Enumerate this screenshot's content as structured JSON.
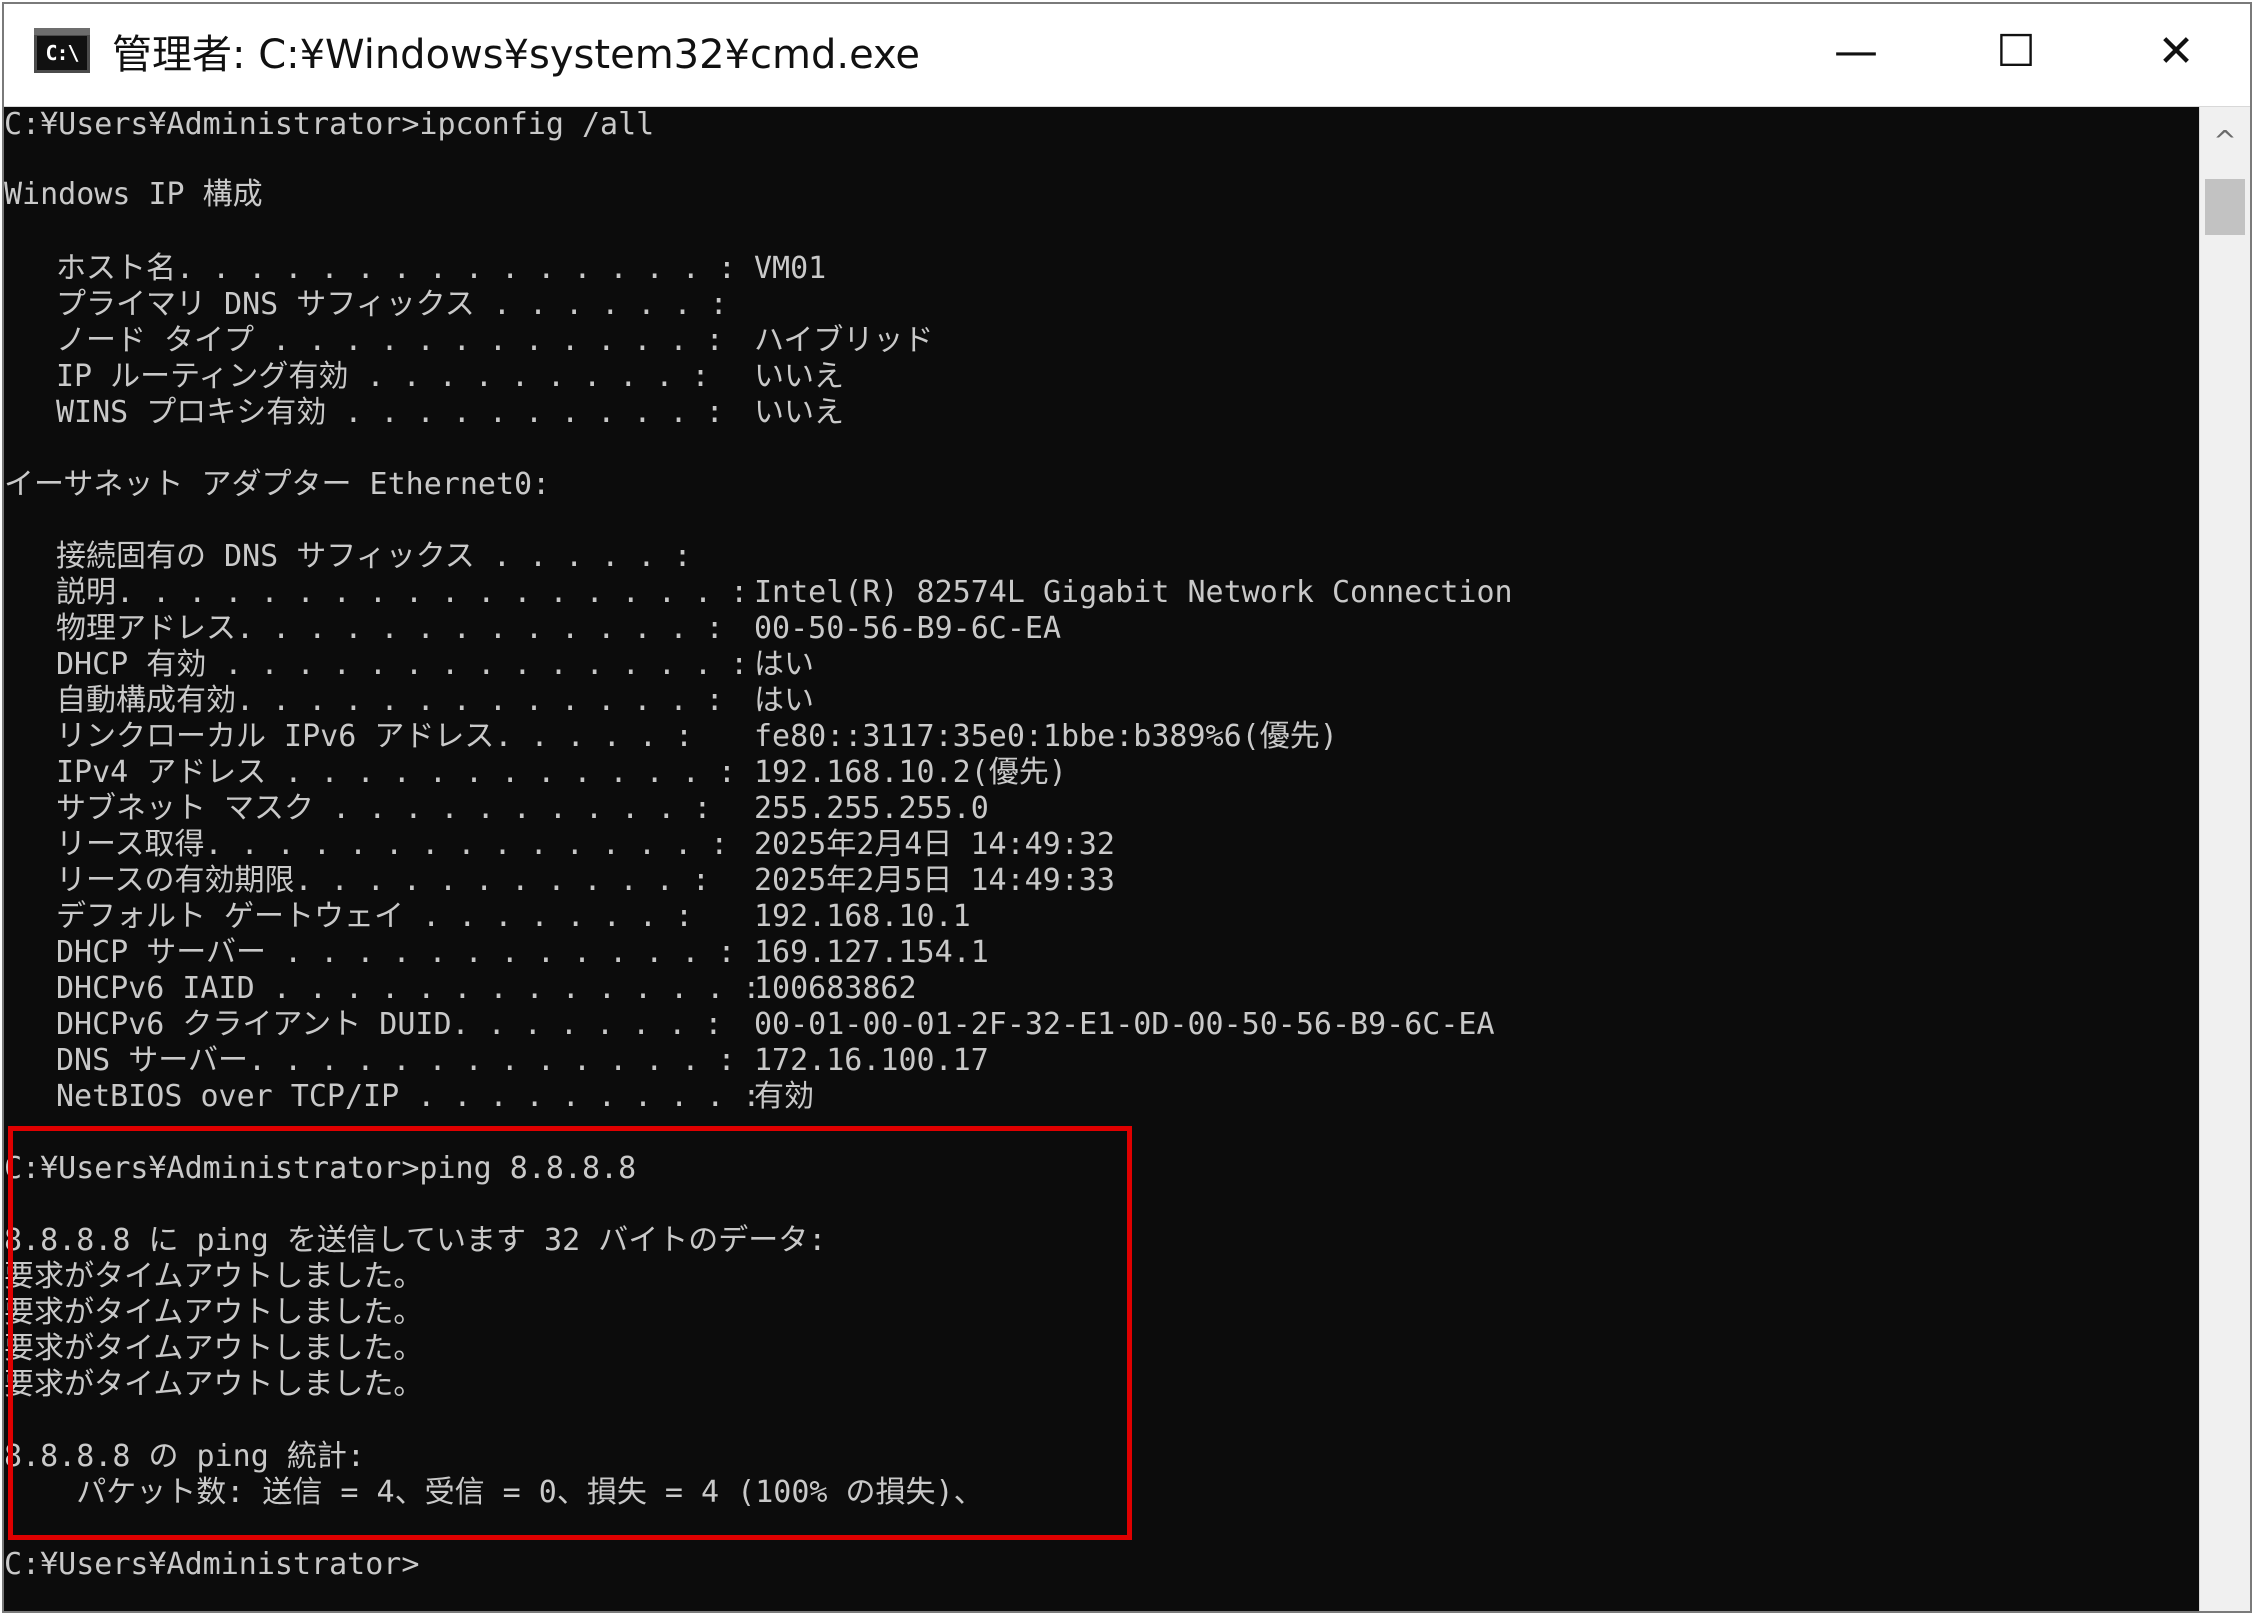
{
  "window": {
    "title": "管理者: C:¥Windows¥system32¥cmd.exe",
    "icon_text": "C:\\",
    "minimize_icon": "—",
    "maximize_icon": "☐",
    "close_icon": "✕"
  },
  "console": {
    "lines": [
      "C:¥Users¥Administrator>ipconfig /all",
      "",
      "Windows IP 構成",
      "",
      "イーサネット アダプター Ethernet0:",
      "",
      "C:¥Users¥Administrator>ping 8.8.8.8",
      "",
      "8.8.8.8 に ping を送信しています 32 バイトのデータ:",
      "要求がタイムアウトしました。",
      "要求がタイムアウトしました。",
      "要求がタイムアウトしました。",
      "要求がタイムアウトしました。",
      "",
      "8.8.8.8 の ping 統計:",
      "    パケット数: 送信 = 4、受信 = 0、損失 = 4 (100% の損失)、",
      "",
      "C:¥Users¥Administrator>"
    ],
    "windows_ip_config": [
      {
        "label": "ホスト名. . . . . . . . . . . . . . . :",
        "value": "VM01"
      },
      {
        "label": "プライマリ DNS サフィックス . . . . . . :",
        "value": ""
      },
      {
        "label": "ノード タイプ . . . . . . . . . . . . :",
        "value": "ハイブリッド"
      },
      {
        "label": "IP ルーティング有効 . . . . . . . . . :",
        "value": "いいえ"
      },
      {
        "label": "WINS プロキシ有効 . . . . . . . . . . :",
        "value": "いいえ"
      }
    ],
    "ethernet_config": [
      {
        "label": "接続固有の DNS サフィックス . . . . . :",
        "value": ""
      },
      {
        "label": "説明. . . . . . . . . . . . . . . . . :",
        "value": "Intel(R) 82574L Gigabit Network Connection"
      },
      {
        "label": "物理アドレス. . . . . . . . . . . . . :",
        "value": "00-50-56-B9-6C-EA"
      },
      {
        "label": "DHCP 有効 . . . . . . . . . . . . . . :",
        "value": "はい"
      },
      {
        "label": "自動構成有効. . . . . . . . . . . . . :",
        "value": "はい"
      },
      {
        "label": "リンクローカル IPv6 アドレス. . . . . :",
        "value": "fe80::3117:35e0:1bbe:b389%6(優先)"
      },
      {
        "label": "IPv4 アドレス . . . . . . . . . . . . :",
        "value": "192.168.10.2(優先)"
      },
      {
        "label": "サブネット マスク . . . . . . . . . . :",
        "value": "255.255.255.0"
      },
      {
        "label": "リース取得. . . . . . . . . . . . . . :",
        "value": "2025年2月4日 14:49:32"
      },
      {
        "label": "リースの有効期限. . . . . . . . . . . :",
        "value": "2025年2月5日 14:49:33"
      },
      {
        "label": "デフォルト ゲートウェイ . . . . . . . :",
        "value": "192.168.10.1"
      },
      {
        "label": "DHCP サーバー . . . . . . . . . . . . :",
        "value": "169.127.154.1"
      },
      {
        "label": "DHCPv6 IAID . . . . . . . . . . . . . :",
        "value": "100683862"
      },
      {
        "label": "DHCPv6 クライアント DUID. . . . . . . :",
        "value": "00-01-00-01-2F-32-E1-0D-00-50-56-B9-6C-EA"
      },
      {
        "label": "DNS サーバー. . . . . . . . . . . . . :",
        "value": "172.16.100.17"
      },
      {
        "label": "NetBIOS over TCP/IP . . . . . . . . . :",
        "value": "有効"
      }
    ]
  },
  "scrollbar": {
    "up_icon": "^"
  },
  "colors": {
    "console_background": "#0c0c0c",
    "console_text": "#c9c9c9",
    "highlight_border": "#e00000",
    "titlebar_background": "#ffffff"
  }
}
